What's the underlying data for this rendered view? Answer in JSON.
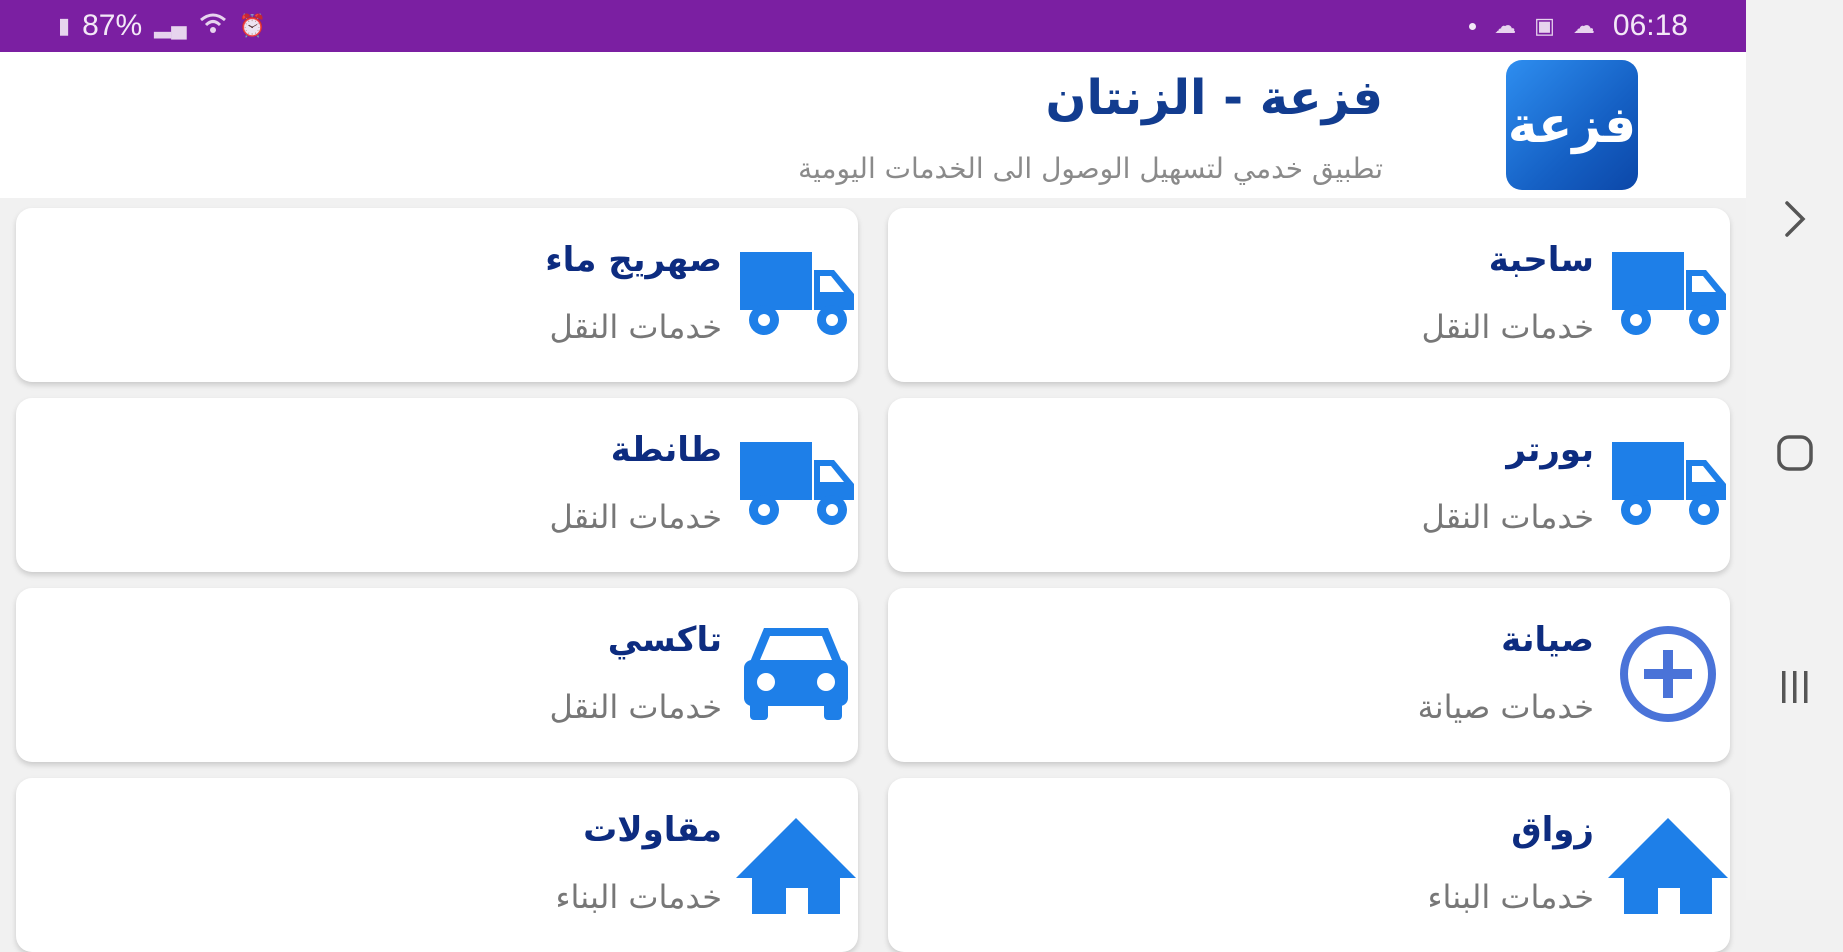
{
  "status_bar": {
    "battery_text": "87%",
    "time": "06:18"
  },
  "header": {
    "logo_text": "فزعة",
    "title": "فزعة - الزنتان",
    "subtitle": "تطبيق خدمي لتسهيل الوصول الى الخدمات اليومية"
  },
  "services": [
    {
      "title": "ساحبة",
      "subtitle": "خدمات النقل",
      "icon": "truck-icon"
    },
    {
      "title": "صهريج ماء",
      "subtitle": "خدمات النقل",
      "icon": "truck-icon"
    },
    {
      "title": "بورتر",
      "subtitle": "خدمات النقل",
      "icon": "truck-icon"
    },
    {
      "title": "طانطة",
      "subtitle": "خدمات النقل",
      "icon": "truck-icon"
    },
    {
      "title": "صيانة",
      "subtitle": "خدمات صيانة",
      "icon": "add-circle-icon"
    },
    {
      "title": "تاكسي",
      "subtitle": "خدمات النقل",
      "icon": "car-icon"
    },
    {
      "title": "زواق",
      "subtitle": "خدمات البناء",
      "icon": "house-icon"
    },
    {
      "title": "مقاولات",
      "subtitle": "خدمات البناء",
      "icon": "house-icon"
    }
  ],
  "colors": {
    "status_bar": "#7b1fa2",
    "accent_blue": "#1e7fe8",
    "title_navy": "#0d2c80",
    "logo_blue": "#1560c4"
  },
  "navigation_bar": {
    "buttons": [
      "chevron-right-icon",
      "home-square-icon",
      "recents-icon"
    ]
  }
}
